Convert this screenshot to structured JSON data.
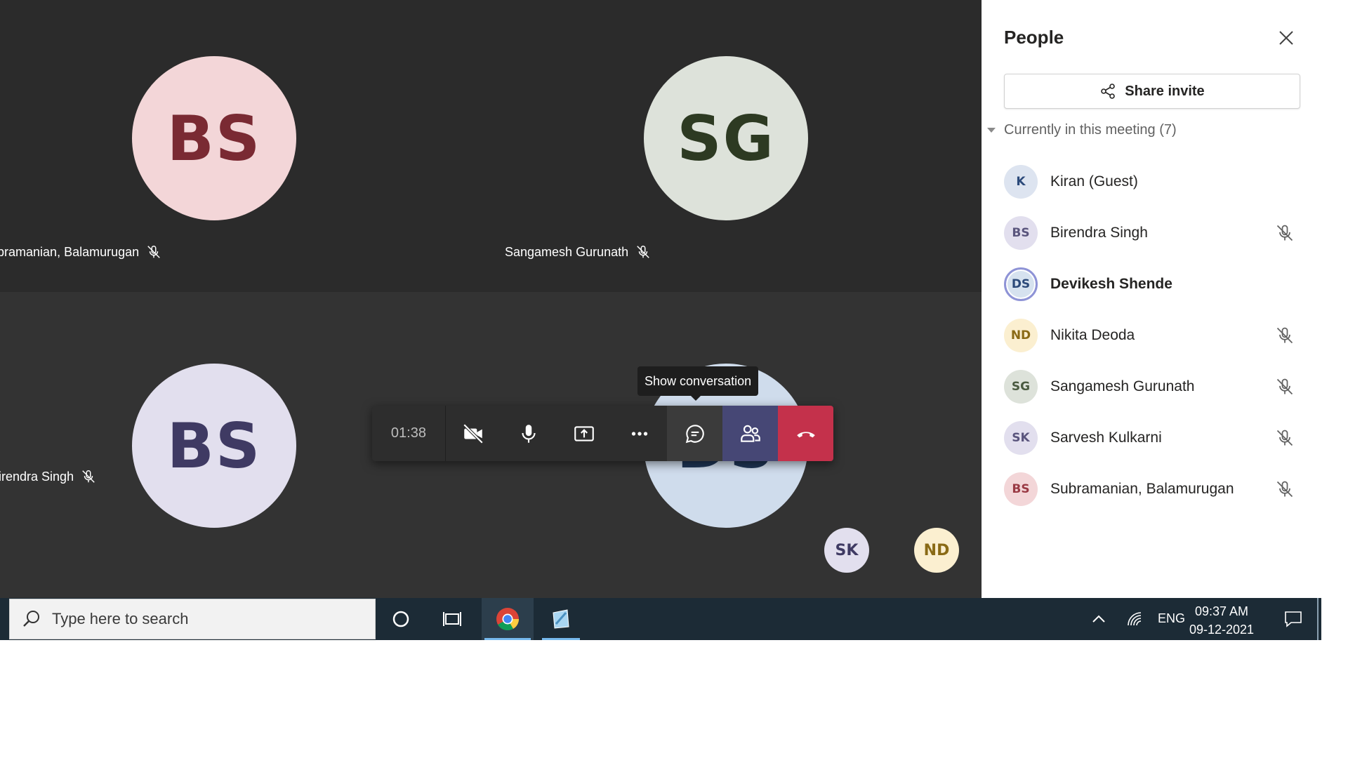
{
  "tiles": [
    {
      "initials": "BS",
      "name": "Subramanian, Balamurugan",
      "bg": "#f3d6d8",
      "fg": "#7a2a33"
    },
    {
      "initials": "SG",
      "name": "Sangamesh Gurunath",
      "bg": "#dde2da",
      "fg": "#2d3a22"
    },
    {
      "initials": "BS",
      "name": "Birendra Singh",
      "bg": "#e2dfee",
      "fg": "#3f3a63"
    },
    {
      "initials": "DS"
    }
  ],
  "overflow_avatars": [
    {
      "initials": "SK",
      "bg": "#e2dfee",
      "fg": "#3f3a63"
    },
    {
      "initials": "ND",
      "bg": "#fbefd0",
      "fg": "#8a6a15"
    }
  ],
  "toolbar": {
    "timer": "01:38",
    "tooltip": "Show conversation",
    "buttons": [
      "camera-off-icon",
      "microphone-icon",
      "share-screen-icon",
      "more-options-icon",
      "chat-icon",
      "people-icon",
      "hang-up-icon"
    ]
  },
  "people_panel": {
    "title": "People",
    "share_invite": "Share invite",
    "section_label": "Currently in this meeting (7)",
    "participants": [
      {
        "initials": "K",
        "name": "Kiran (Guest)",
        "muted": false,
        "bg": "#dde4f0",
        "fg": "#2c4a7a"
      },
      {
        "initials": "BS",
        "name": "Birendra Singh",
        "muted": true,
        "bg": "#e2dfee",
        "fg": "#5a557d"
      },
      {
        "initials": "DS",
        "name": "Devikesh Shende",
        "muted": false,
        "bg": "#d6e2ef",
        "fg": "#2c4a7a",
        "current_user": true
      },
      {
        "initials": "ND",
        "name": "Nikita Deoda",
        "muted": true,
        "bg": "#fbefd0",
        "fg": "#8a6a15"
      },
      {
        "initials": "SG",
        "name": "Sangamesh Gurunath",
        "muted": true,
        "bg": "#dde2da",
        "fg": "#4a5a40"
      },
      {
        "initials": "SK",
        "name": "Sarvesh Kulkarni",
        "muted": true,
        "bg": "#e2dfee",
        "fg": "#5a557d"
      },
      {
        "initials": "BS",
        "name": "Subramanian, Balamurugan",
        "muted": true,
        "bg": "#f3d6d8",
        "fg": "#9a3a44"
      }
    ]
  },
  "taskbar": {
    "search_placeholder": "Type here to search",
    "language": "ENG",
    "time": "09:37 AM",
    "date": "09-12-2021"
  }
}
